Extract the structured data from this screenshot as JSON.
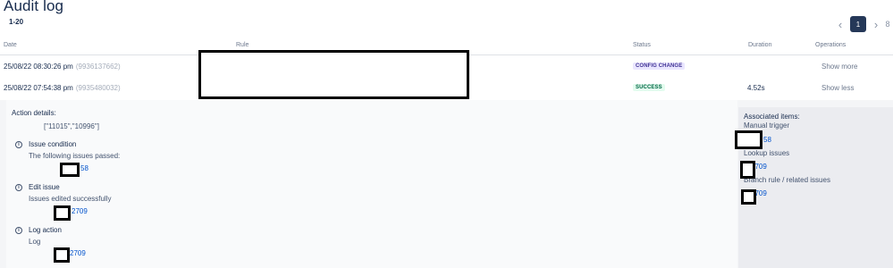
{
  "page": {
    "title": "Audit log",
    "range": "1-20"
  },
  "pagination": {
    "prev_icon": "chevron-left-icon",
    "current": "1",
    "next_icon": "chevron-right-icon",
    "more": "8"
  },
  "columns": {
    "date": "Date",
    "rule": "Rule",
    "status": "Status",
    "duration": "Duration",
    "operations": "Operations"
  },
  "rows": [
    {
      "date": "25/08/22 08:30:26 pm",
      "id": "(9936137662)",
      "status": "CONFIG CHANGE",
      "status_color": "#403294",
      "duration": "",
      "operation": "Show more"
    },
    {
      "date": "25/08/22 07:54:38 pm",
      "id": "(9935480032)",
      "status": "SUCCESS",
      "status_color": "#006644",
      "duration": "4.52s",
      "operation": "Show less"
    }
  ],
  "details": {
    "heading": "Action details:",
    "ids": "[\"11015\",\"10996\"]",
    "actions": [
      {
        "icon": "info-icon",
        "title": "Issue condition",
        "desc": "The following issues passed:",
        "link_suffix": "58"
      },
      {
        "icon": "info-icon",
        "title": "Edit issue",
        "desc": "Issues edited successfully",
        "link_suffix": "2709"
      },
      {
        "icon": "info-icon",
        "title": "Log action",
        "desc": "Log",
        "link_suffix": "2709"
      }
    ]
  },
  "associated": {
    "heading": "Associated items:",
    "groups": [
      {
        "label": "Manual trigger",
        "link_suffix": "58"
      },
      {
        "label": "Lookup issues",
        "link_suffix": "2709"
      },
      {
        "label": "Branch rule / related issues",
        "link_suffix": "2709"
      }
    ]
  }
}
